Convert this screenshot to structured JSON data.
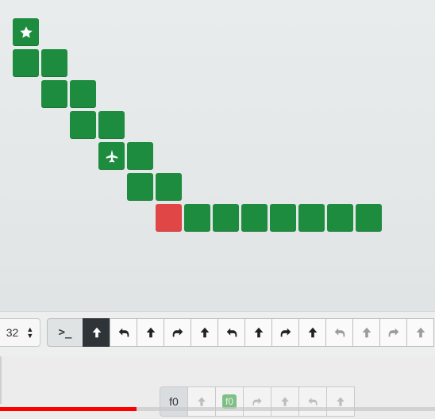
{
  "board": {
    "tiles": [
      {
        "col": 0,
        "row": 0,
        "icon": "star-icon"
      },
      {
        "col": 0,
        "row": 1
      },
      {
        "col": 1,
        "row": 1
      },
      {
        "col": 1,
        "row": 2
      },
      {
        "col": 2,
        "row": 2
      },
      {
        "col": 2,
        "row": 3
      },
      {
        "col": 3,
        "row": 3
      },
      {
        "col": 3,
        "row": 4,
        "icon": "plane-icon"
      },
      {
        "col": 4,
        "row": 4
      },
      {
        "col": 4,
        "row": 5
      },
      {
        "col": 5,
        "row": 5
      },
      {
        "col": 5,
        "row": 6,
        "color": "red"
      },
      {
        "col": 6,
        "row": 6
      },
      {
        "col": 7,
        "row": 6
      },
      {
        "col": 8,
        "row": 6
      },
      {
        "col": 9,
        "row": 6
      },
      {
        "col": 10,
        "row": 6
      },
      {
        "col": 11,
        "row": 6
      },
      {
        "col": 12,
        "row": 6
      }
    ]
  },
  "toolbar": {
    "speed_value": "32",
    "terminal_label": ">_",
    "program": [
      "up",
      "left",
      "up",
      "right",
      "up",
      "left",
      "up",
      "right",
      "up",
      "left",
      "up",
      "right",
      "up"
    ],
    "active_index": 0
  },
  "function_row": {
    "label": "f0",
    "commands": [
      "up",
      "f0",
      "right",
      "up",
      "left",
      "up"
    ]
  },
  "colors": {
    "tile_green": "#1e8c3e",
    "tile_red": "#e04646",
    "active_command": "#2f3438"
  }
}
